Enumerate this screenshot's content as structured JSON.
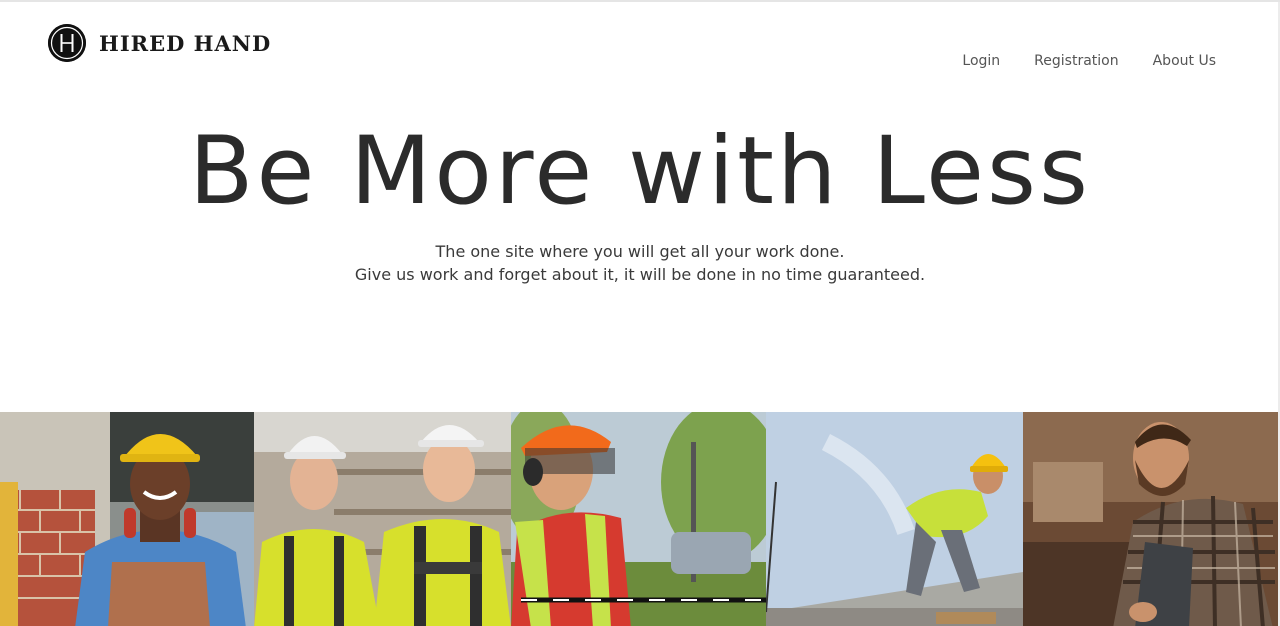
{
  "brand": {
    "name": "HIRED HAND",
    "logo_letter": "H"
  },
  "nav": {
    "items": [
      {
        "label": "Login"
      },
      {
        "label": "Registration"
      },
      {
        "label": "About Us"
      }
    ]
  },
  "hero": {
    "title": "Be More with Less",
    "subtitle_line1": "The one site where you will get all your work done.",
    "subtitle_line2": "Give us work and forget about it, it will be done in no time guaranteed."
  },
  "photos": [
    {
      "subject": "worker-yellow-helmet-ear-defenders"
    },
    {
      "subject": "two-workers-white-helmets-hi-vis"
    },
    {
      "subject": "worker-orange-helmet-visor-red-shirt"
    },
    {
      "subject": "worker-yellow-helmet-on-concrete-wall"
    },
    {
      "subject": "bearded-carpenter-plaid-shirt"
    }
  ],
  "colors": {
    "text": "#2b2b2b",
    "nav_text": "#555555",
    "logo_bg": "#111111"
  }
}
